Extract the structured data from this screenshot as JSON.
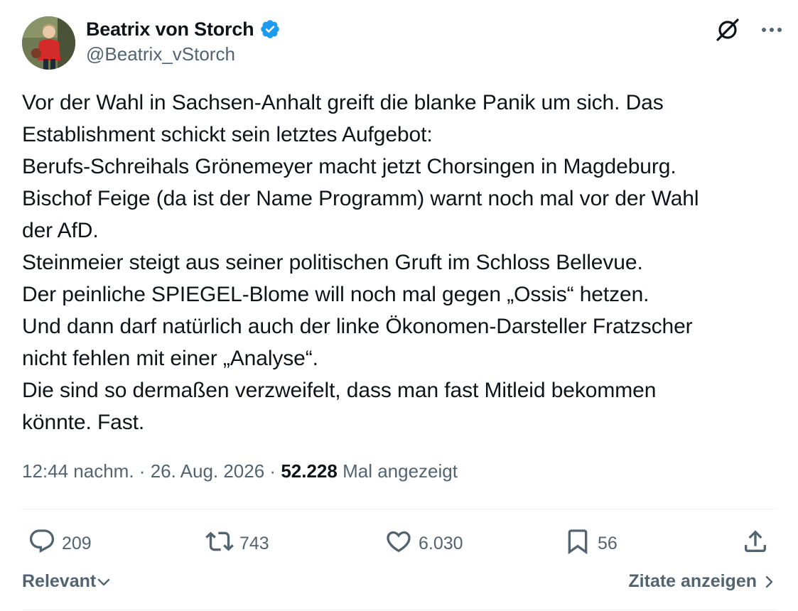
{
  "author": {
    "display_name": "Beatrix von Storch",
    "handle": "@Beatrix_vStorch",
    "verified": true
  },
  "icons": {
    "verified": "verified-badge-icon",
    "grok": "grok-icon",
    "more": "more-icon",
    "reply": "reply-icon",
    "repost": "repost-icon",
    "like": "heart-icon",
    "bookmark": "bookmark-icon",
    "share": "share-icon"
  },
  "colors": {
    "verified_blue": "#1d9bf0",
    "secondary_text": "#536471",
    "primary_text": "#0f1419"
  },
  "tweet": {
    "text": "Vor der Wahl in Sachsen-Anhalt greift die blanke Panik um sich. Das\nEstablishment schickt sein letztes Aufgebot:\nBerufs-Schreihals Grönemeyer macht jetzt Chorsingen in Magdeburg.\nBischof Feige (da ist der Name Programm) warnt noch mal vor der Wahl\nder AfD.\nSteinmeier steigt aus seiner politischen Gruft im Schloss Bellevue.\nDer peinliche SPIEGEL-Blome will noch mal gegen „Ossis“ hetzen.\nUnd dann darf natürlich auch der linke Ökonomen-Darsteller Fratzscher\nnicht fehlen mit einer „Analyse“.\nDie sind so dermaßen verzweifelt, dass man fast Mitleid bekommen\nkönnte. Fast.",
    "time": "12:44 nachm.",
    "date": "26. Aug. 2026",
    "separator": "·",
    "views_count": "52.228",
    "views_label": "Mal angezeigt"
  },
  "actions": {
    "replies": "209",
    "reposts": "743",
    "likes": "6.030",
    "bookmarks": "56"
  },
  "footer": {
    "sort_label": "Relevant",
    "quotes_label": "Zitate anzeigen"
  }
}
